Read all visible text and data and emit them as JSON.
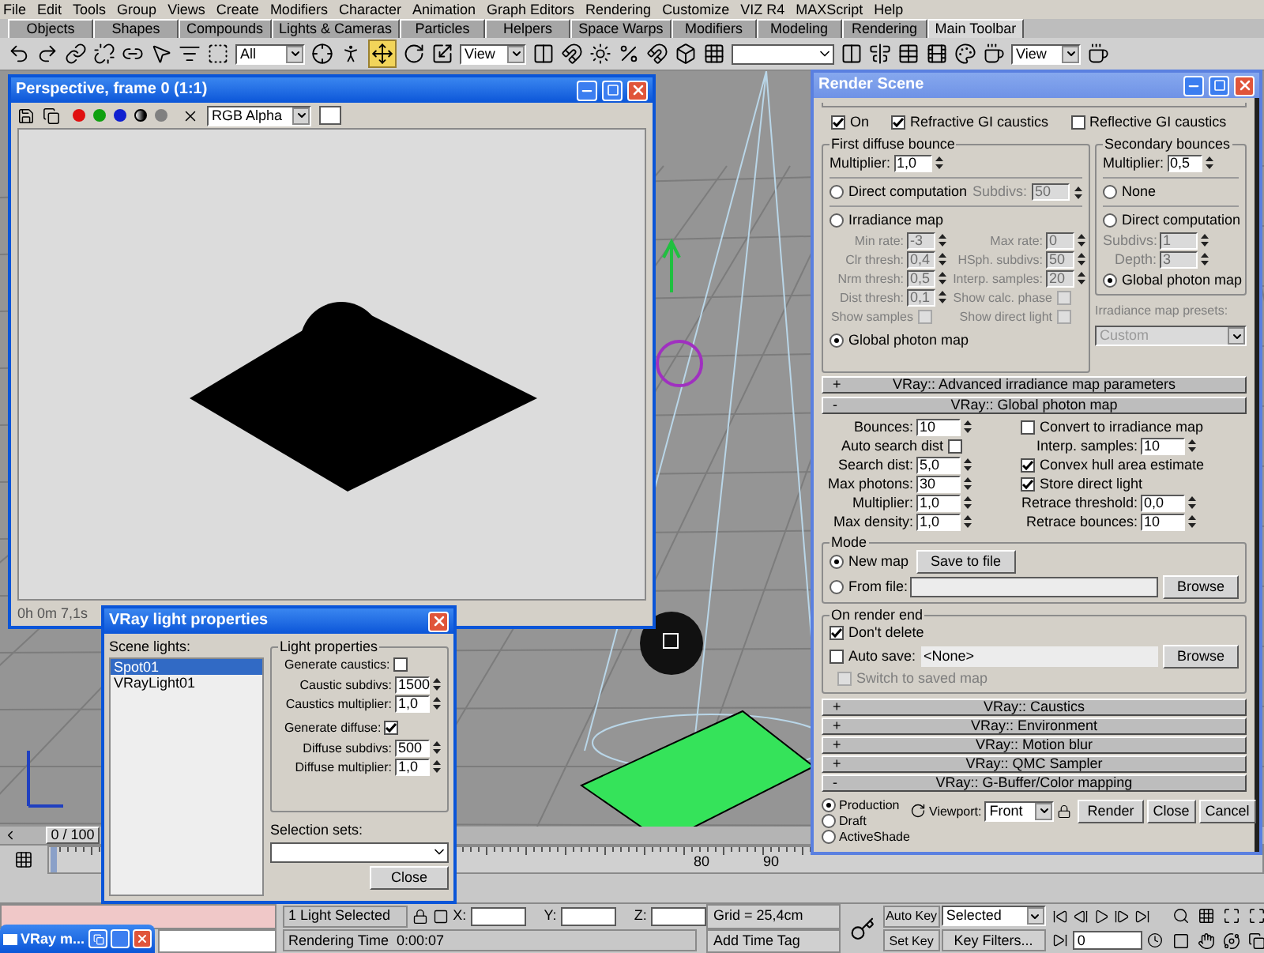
{
  "menu_bar": [
    "File",
    "Edit",
    "Tools",
    "Group",
    "Views",
    "Create",
    "Modifiers",
    "Character",
    "Animation",
    "Graph Editors",
    "Rendering",
    "Customize",
    "VIZ R4",
    "MAXScript",
    "Help"
  ],
  "command_tabs": [
    {
      "label": "Objects",
      "selected": false
    },
    {
      "label": "Shapes",
      "selected": false
    },
    {
      "label": "Compounds",
      "selected": false
    },
    {
      "label": "Lights & Cameras",
      "selected": false
    },
    {
      "label": "Particles",
      "selected": false
    },
    {
      "label": "Helpers",
      "selected": false
    },
    {
      "label": "Space Warps",
      "selected": false
    },
    {
      "label": "Modifiers",
      "selected": false
    },
    {
      "label": "Modeling",
      "selected": false
    },
    {
      "label": "Rendering",
      "selected": false
    },
    {
      "label": "Main Toolbar",
      "selected": true
    }
  ],
  "toolbar": {
    "selection_filter": "All",
    "move_tool": {
      "selected": true
    },
    "reference_coordinate": "View",
    "render_view": "View"
  },
  "render_frame": {
    "title": "Perspective, frame 0 (1:1)",
    "channel": "RGB Alpha",
    "status": "0h 0m 7,1s"
  },
  "render_scene": {
    "title": "Render Scene",
    "gi_options": [
      {
        "label": "On",
        "checked": true
      },
      {
        "label": "Refractive GI caustics",
        "checked": true
      },
      {
        "label": "Reflective GI caustics",
        "checked": false
      }
    ],
    "first_bounce": {
      "title": "First diffuse bounce",
      "multiplier_label": "Multiplier:",
      "multiplier": "1,0",
      "subdivs_label": "Subdivs:",
      "subdivs": "50",
      "engines": [
        {
          "label": "Direct computation",
          "selected": false
        },
        {
          "label": "Irradiance map",
          "selected": false
        },
        {
          "label": "Global photon map",
          "selected": true
        }
      ],
      "irradiance_fields": [
        {
          "kind": "spinner",
          "label": "Min rate:",
          "value": "-3"
        },
        {
          "kind": "spinner",
          "label": "Max rate:",
          "value": "0"
        },
        {
          "kind": "spinner",
          "label": "Clr thresh:",
          "value": "0,4"
        },
        {
          "kind": "spinner",
          "label": "HSph. subdivs:",
          "value": "50"
        },
        {
          "kind": "spinner",
          "label": "Nrm thresh:",
          "value": "0,5"
        },
        {
          "kind": "spinner",
          "label": "Interp. samples:",
          "value": "20"
        },
        {
          "kind": "spinner",
          "label": "Dist thresh:",
          "value": "0,1"
        },
        {
          "kind": "check",
          "label": "Show calc. phase",
          "checked": false
        },
        {
          "kind": "check",
          "label": "Show samples",
          "checked": false
        },
        {
          "kind": "check",
          "label": "Show direct light",
          "checked": false
        }
      ]
    },
    "secondary_bounce": {
      "title": "Secondary bounces",
      "multiplier_label": "Multiplier:",
      "multiplier": "0,5",
      "subdivs_label": "Subdivs:",
      "subdivs": "1",
      "depth_label": "Depth:",
      "depth": "3",
      "engines": [
        {
          "label": "None",
          "selected": false
        },
        {
          "label": "Direct computation",
          "selected": false
        },
        {
          "label": "Global photon map",
          "selected": true
        }
      ]
    },
    "presets": {
      "label": "Irradiance map presets:",
      "value": "Custom"
    },
    "rollouts_top": [
      {
        "sign": "+",
        "title": "VRay:: Advanced irradiance map parameters"
      },
      {
        "sign": "-",
        "title": "VRay:: Global photon map"
      }
    ],
    "photon_map": {
      "left": [
        {
          "kind": "spinner",
          "label": "Bounces:",
          "value": "10"
        },
        {
          "kind": "check",
          "label": "Auto search dist",
          "checked": false
        },
        {
          "kind": "spinner",
          "label": "Search dist:",
          "value": "5,0"
        },
        {
          "kind": "spinner",
          "label": "Max photons:",
          "value": "30"
        },
        {
          "kind": "spinner",
          "label": "Multiplier:",
          "value": "1,0"
        },
        {
          "kind": "spinner",
          "label": "Max density:",
          "value": "1,0"
        }
      ],
      "right": [
        {
          "kind": "check",
          "label": "Convert to irradiance map",
          "checked": false
        },
        {
          "kind": "spinner",
          "label": "Interp. samples:",
          "value": "10"
        },
        {
          "kind": "check",
          "label": "Convex hull area estimate",
          "checked": true
        },
        {
          "kind": "check",
          "label": "Store direct light",
          "checked": true
        },
        {
          "kind": "spinner",
          "label": "Retrace threshold:",
          "value": "0,0"
        },
        {
          "kind": "spinner",
          "label": "Retrace bounces:",
          "value": "10"
        }
      ]
    },
    "mode": {
      "title": "Mode",
      "options": [
        {
          "label": "New map",
          "selected": true
        },
        {
          "label": "From file:",
          "selected": false
        }
      ],
      "save_button": "Save to file",
      "browse_button": "Browse"
    },
    "render_end": {
      "title": "On render end",
      "dont_delete": {
        "label": "Don't delete",
        "checked": true
      },
      "auto_save": {
        "label": "Auto save:",
        "checked": false,
        "file": "<None>"
      },
      "browse_button": "Browse",
      "switch": {
        "label": "Switch to saved map",
        "checked": false,
        "disabled": true
      }
    },
    "rollouts_bottom": [
      {
        "sign": "+",
        "title": "VRay:: Caustics"
      },
      {
        "sign": "+",
        "title": "VRay:: Environment"
      },
      {
        "sign": "+",
        "title": "VRay:: Motion blur"
      },
      {
        "sign": "+",
        "title": "VRay:: QMC Sampler"
      },
      {
        "sign": "-",
        "title": "VRay:: G-Buffer/Color mapping"
      }
    ],
    "render_types": [
      {
        "label": "Production",
        "selected": true
      },
      {
        "label": "Draft",
        "selected": false
      },
      {
        "label": "ActiveShade",
        "selected": false
      }
    ],
    "viewport_label": "Viewport:",
    "viewport": "Front",
    "buttons": [
      "Render",
      "Close",
      "Cancel"
    ]
  },
  "light_properties": {
    "title": "VRay light properties",
    "scene_lights_label": "Scene lights:",
    "scene_lights": [
      {
        "name": "Spot01",
        "selected": true
      },
      {
        "name": "VRayLight01",
        "selected": false
      }
    ],
    "group_title": "Light properties",
    "fields": [
      {
        "kind": "check",
        "label": "Generate caustics:",
        "checked": false
      },
      {
        "kind": "spinner",
        "label": "Caustic subdivs:",
        "value": "1500"
      },
      {
        "kind": "spinner",
        "label": "Caustics multiplier:",
        "value": "1,0"
      },
      {
        "kind": "check",
        "label": "Generate diffuse:",
        "checked": true
      },
      {
        "kind": "spinner",
        "label": "Diffuse subdivs:",
        "value": "500"
      },
      {
        "kind": "spinner",
        "label": "Diffuse multiplier:",
        "value": "1,0"
      }
    ],
    "selection_sets_label": "Selection sets:",
    "close_button": "Close"
  },
  "minimized_window": {
    "title": "VRay m..."
  },
  "timeline": {
    "position": "0 / 100",
    "ticks": [
      "80",
      "90"
    ]
  },
  "status_bar": {
    "selection": "1 Light Selected",
    "prompt": "Rendering Time  0:00:07",
    "x_label": "X:",
    "y_label": "Y:",
    "z_label": "Z:",
    "grid": "Grid = 25,4cm",
    "time_tag": "Add Time Tag",
    "auto_key": "Auto Key",
    "key_mode": "Selected",
    "set_key": "Set Key",
    "key_filters": "Key Filters...",
    "frame": "0"
  }
}
